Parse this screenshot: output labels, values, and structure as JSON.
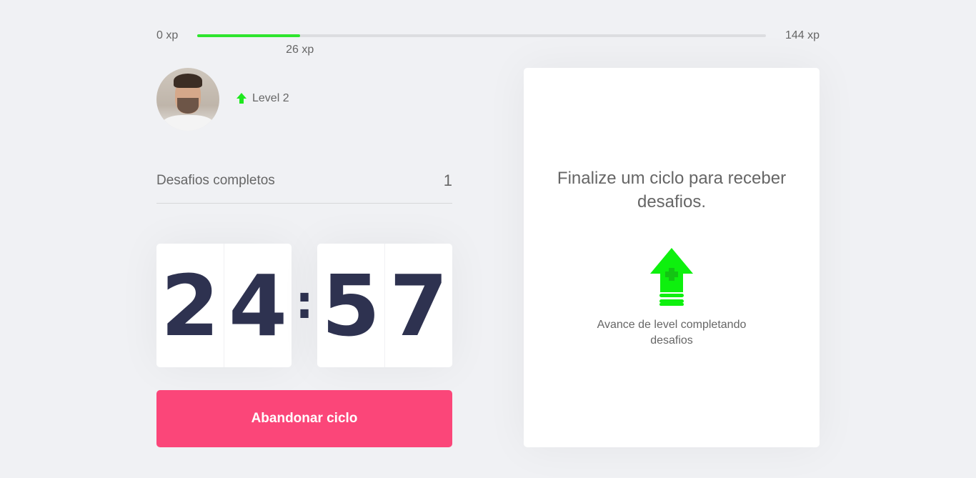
{
  "xp": {
    "min_label": "0 xp",
    "max_label": "144 xp",
    "current_label": "26 xp",
    "current": 26,
    "max": 144,
    "fill_color": "#2ee52e"
  },
  "profile": {
    "avatar_icon": "user-avatar-photo",
    "level_icon": "level-up-arrow-icon",
    "level_label": "Level 2"
  },
  "completed": {
    "label": "Desafios completos",
    "value": "1"
  },
  "countdown": {
    "minute_left": "2",
    "minute_right": "4",
    "separator": ":",
    "second_left": "5",
    "second_right": "7"
  },
  "actions": {
    "abandon_label": "Abandonar ciclo",
    "abandon_color": "#fb4679"
  },
  "challenge": {
    "title": "Finalize um ciclo para receber desafios.",
    "icon": "level-up-icon",
    "hint": "Avance de level completando desafios"
  }
}
